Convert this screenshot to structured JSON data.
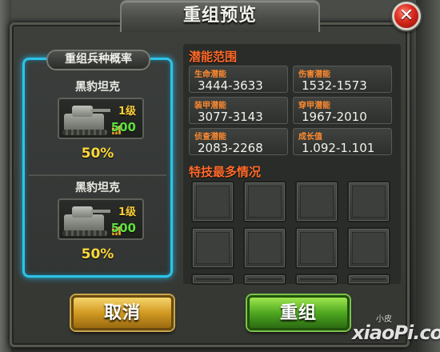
{
  "dialog": {
    "title": "重组预览",
    "close_symbol": "✕",
    "close_icon": "close-icon"
  },
  "unit_panel": {
    "header": "重组兵种概率",
    "units": [
      {
        "name": "黑豹坦克",
        "level": "1级",
        "power": "500",
        "rate": "50%",
        "icon": "tank-icon",
        "power_icon": "ammo-icon"
      },
      {
        "name": "黑豹坦克",
        "level": "1级",
        "power": "500",
        "rate": "50%",
        "icon": "tank-icon",
        "power_icon": "ammo-icon"
      }
    ]
  },
  "potential": {
    "title": "潜能范围",
    "stats": [
      {
        "label": "生命潜能",
        "value": "3444-3633"
      },
      {
        "label": "伤害潜能",
        "value": "1532-1573"
      },
      {
        "label": "装甲潜能",
        "value": "3077-3143"
      },
      {
        "label": "穿甲潜能",
        "value": "1967-2010"
      },
      {
        "label": "侦查潜能",
        "value": "2083-2268"
      },
      {
        "label": "成长值",
        "value": "1.092-1.101"
      }
    ]
  },
  "skills": {
    "title": "特技最多情况",
    "visible_slots": 12
  },
  "buttons": {
    "cancel": "取消",
    "confirm": "重组"
  },
  "watermark": {
    "small": "小皮",
    "main": "xiaoPi.com"
  },
  "colors": {
    "accent_title": "#ff6a2b",
    "stat_label": "#ff8a2f",
    "panel_glow": "#2ec3e8",
    "rate_yellow": "#ffd83a",
    "power_green": "#5fe03e",
    "cancel_gold": "#d29a23",
    "confirm_green": "#4fa820"
  }
}
